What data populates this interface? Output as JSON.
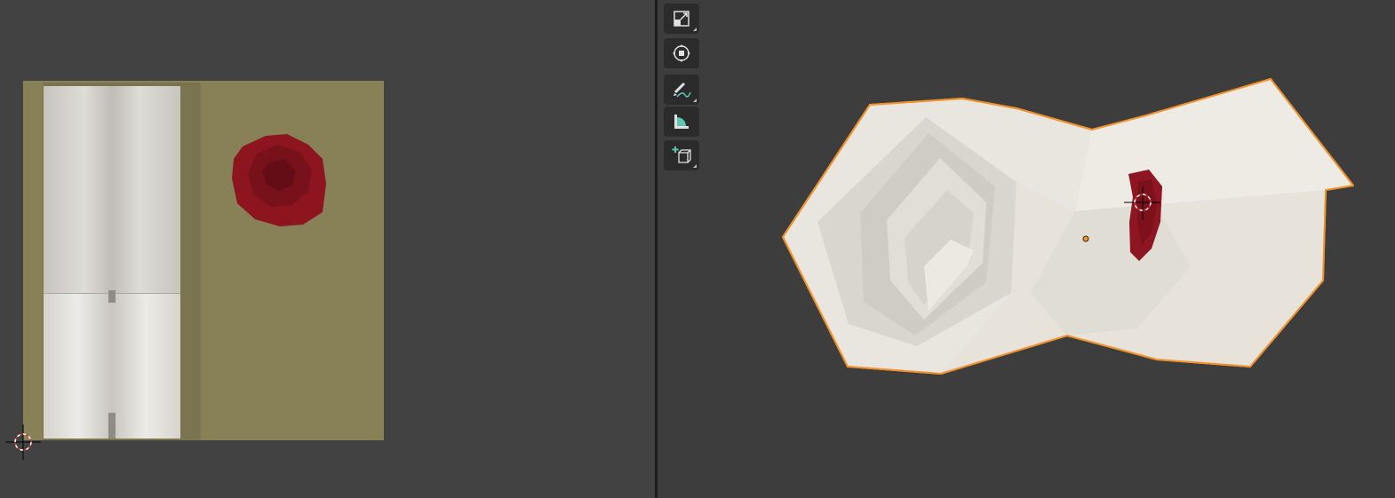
{
  "uv_editor": {
    "title": "",
    "image_background_color": "#888056",
    "icons": [
      "2d-cursor-icon"
    ]
  },
  "viewport_3d": {
    "toolbar": [
      {
        "name": "scale-tool",
        "icon": "scale-icon",
        "has_submenu": true
      },
      {
        "name": "transform-tool",
        "icon": "transform-icon",
        "has_submenu": false
      },
      {
        "name": "annotate-tool",
        "icon": "annotate-pencil-icon",
        "has_submenu": true
      },
      {
        "name": "measure-tool",
        "icon": "measure-ruler-icon",
        "has_submenu": false
      },
      {
        "name": "add-cube-tool",
        "icon": "add-cube-icon",
        "has_submenu": true
      }
    ],
    "selection_outline_color": "#f0922e",
    "object_fill_color": "#e8e4dc",
    "accent_red": "#8e1522"
  }
}
